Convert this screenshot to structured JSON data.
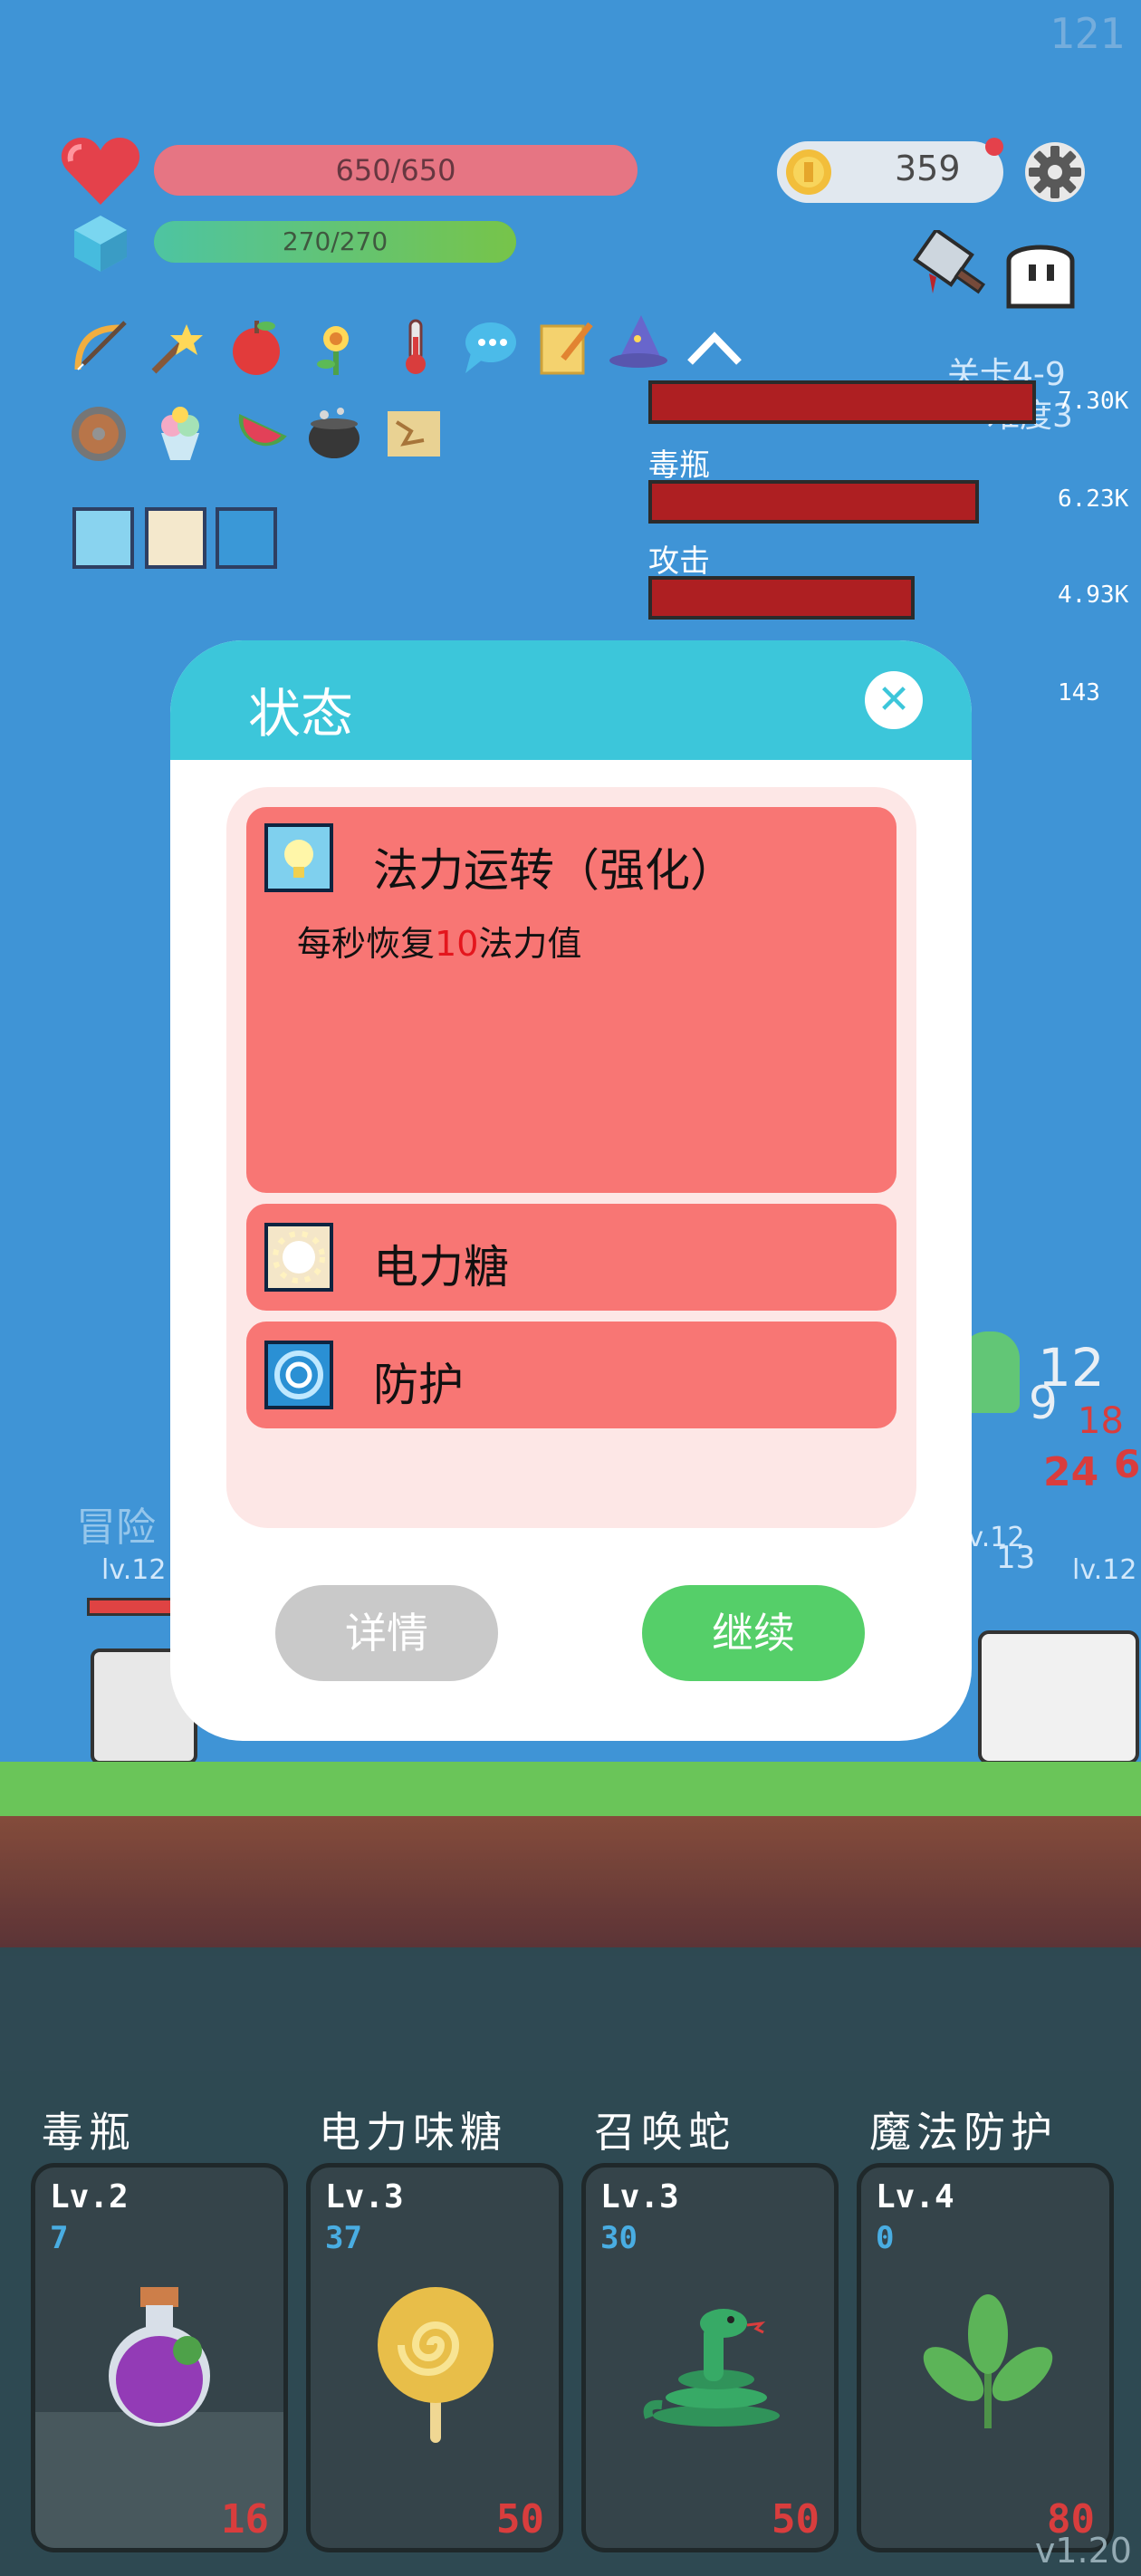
{
  "fps": "121",
  "player": {
    "hp_text": "650/650",
    "hp_fraction": 1.0,
    "mp_text": "270/270",
    "mp_fraction": 1.0
  },
  "gold": "359",
  "stage": {
    "level": "关卡4-9",
    "difficulty": "难度3"
  },
  "damage_stats": [
    {
      "label": "",
      "value": "7.30K",
      "fraction": 1.0
    },
    {
      "label": "毒瓶",
      "value": "6.23K",
      "fraction": 0.85
    },
    {
      "label": "攻击",
      "value": "4.93K",
      "fraction": 0.68
    },
    {
      "label": "",
      "value": "143",
      "fraction": 0.05
    }
  ],
  "background_text": {
    "adventurer": "冒险",
    "player_level": "lv.12",
    "enemy_level_1": "lv.12",
    "enemy_level_2": "lv.12",
    "dmg_1": "12",
    "dmg_2": "9",
    "dmg_3": "18",
    "dmg_4": "24",
    "dmg_5": "13",
    "dmg_6": "18",
    "dmg_7": "6"
  },
  "dialog": {
    "title": "状态",
    "close_icon": "close-icon",
    "statuses": [
      {
        "name": "法力运转（强化）",
        "desc_prefix": "每秒恢复",
        "desc_value": "10",
        "desc_suffix": "法力值",
        "icon": "bulb-icon"
      },
      {
        "name": "电力糖",
        "icon": "spark-icon"
      },
      {
        "name": "防护",
        "icon": "shield-swirl-icon"
      }
    ],
    "detail_button": "详情",
    "continue_button": "继续"
  },
  "skills": [
    {
      "title": "毒瓶",
      "level": "Lv.2",
      "count": "7",
      "cost": "16",
      "icon": "potion-icon"
    },
    {
      "title": "电力味糖",
      "level": "Lv.3",
      "count": "37",
      "cost": "50",
      "icon": "lollipop-icon"
    },
    {
      "title": "召唤蛇",
      "level": "Lv.3",
      "count": "30",
      "cost": "50",
      "icon": "snake-icon"
    },
    {
      "title": "魔法防护",
      "level": "Lv.4",
      "count": "0",
      "cost": "80",
      "icon": "leaf-icon"
    }
  ],
  "version": "v1.20",
  "colors": {
    "sky": "#2f8bd3",
    "hp": "#e46a79",
    "mp": "#4fbe47",
    "dialog_header": "#3cc6da",
    "status_card": "#f87674",
    "continue": "#55cf69",
    "detail": "#c9c9c9"
  }
}
